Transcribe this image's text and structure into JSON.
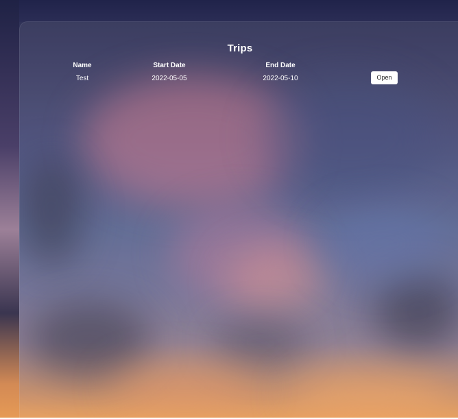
{
  "page": {
    "title": "Trips"
  },
  "table": {
    "columns": [
      "Name",
      "Start Date",
      "End Date"
    ],
    "rows": [
      {
        "name": "Test",
        "start_date": "2022-05-05",
        "end_date": "2022-05-10",
        "action_label": "Open"
      }
    ]
  },
  "colors": {
    "text": "#ffffff",
    "button_bg": "#ffffff",
    "button_text": "#222222"
  }
}
